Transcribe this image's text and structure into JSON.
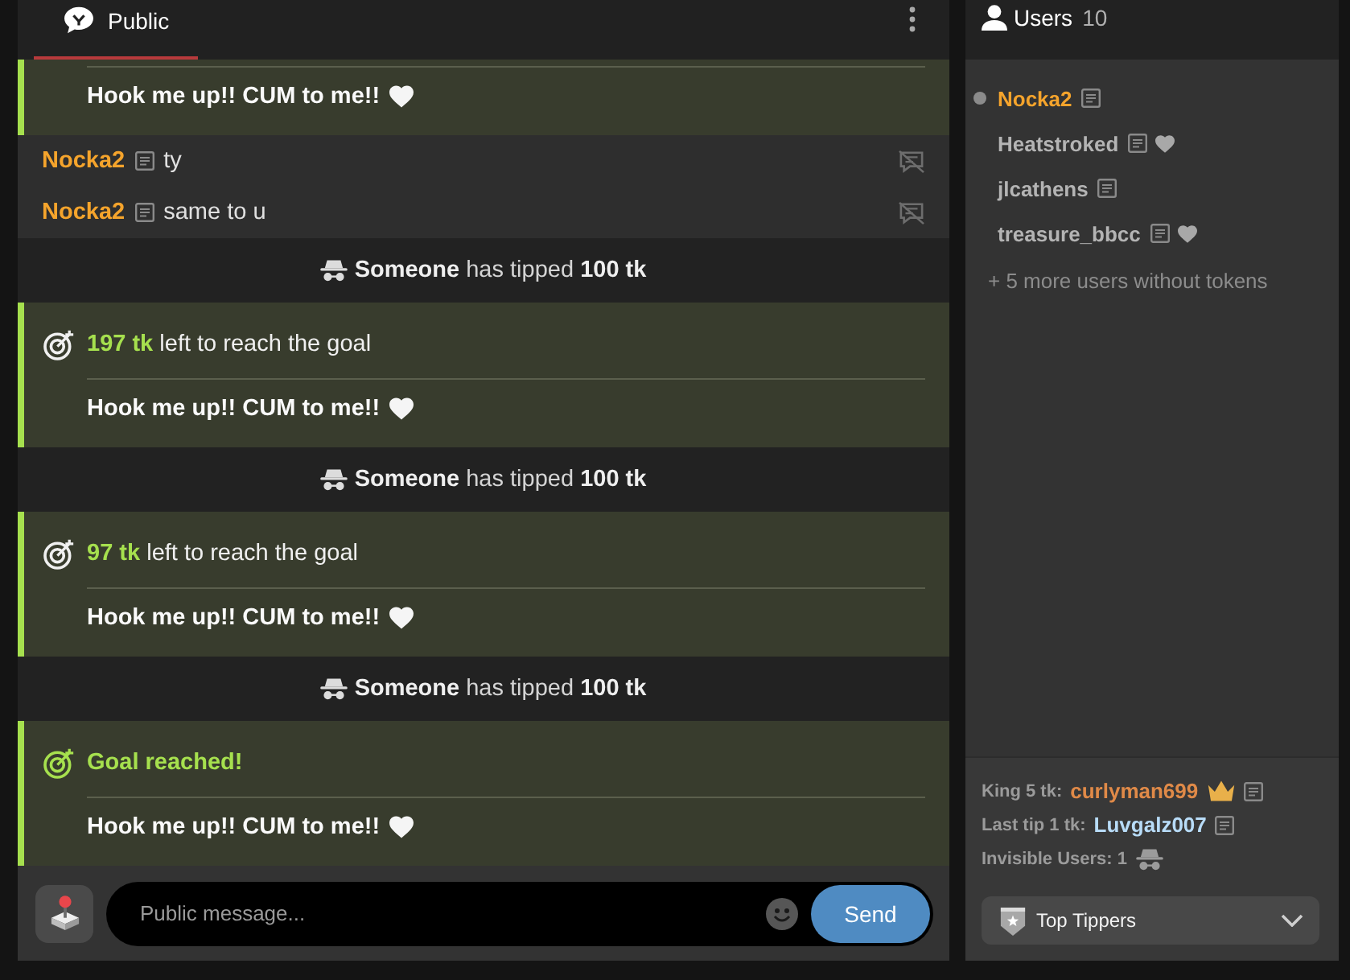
{
  "chat_tabs": [
    {
      "label": "Public",
      "selected": true
    }
  ],
  "messages": [
    {
      "kind": "goal",
      "text": "Hook me up!! CUM to me!!"
    },
    {
      "kind": "chat",
      "user": "Nocka2",
      "color": "#f5a42c",
      "text": "ty"
    },
    {
      "kind": "chat",
      "user": "Nocka2",
      "color": "#f5a42c",
      "text": "same to u"
    },
    {
      "kind": "tip",
      "text": "**Someone** has tipped **100 tk**"
    },
    {
      "kind": "goal",
      "reached": false,
      "headline": "**197 tk** left to reach the goal",
      "text": "Hook me up!! CUM to me!!"
    },
    {
      "kind": "tip",
      "text": "**Someone** has tipped **100 tk**"
    },
    {
      "kind": "goal",
      "reached": false,
      "headline": "**97 tk** left to reach the goal",
      "text": "Hook me up!! CUM to me!!"
    },
    {
      "kind": "tip",
      "text": "**Someone** has tipped **100 tk**"
    },
    {
      "kind": "goal",
      "reached": true,
      "headline": "Goal reached!",
      "text": "Hook me up!! CUM to me!!"
    }
  ],
  "composer": {
    "placeholder": "Public message...",
    "send": "Send"
  },
  "users_panel": {
    "title": "Users",
    "count": "10",
    "users": [
      {
        "name": "Nocka2",
        "color": "#f5a42c",
        "current": true,
        "favorite": false
      },
      {
        "name": "Heatstroked",
        "color": "#b4b4b4",
        "current": false,
        "favorite": true
      },
      {
        "name": "jlcathens",
        "color": "#b4b4b4",
        "current": false,
        "favorite": false
      },
      {
        "name": "treasure_bbcc",
        "color": "#b4b4b4",
        "current": false,
        "favorite": true
      }
    ],
    "more": "+ 5 more users without tokens"
  },
  "stats": [
    {
      "kind": "king",
      "label": "King 5 tk:",
      "user": "curlyman699",
      "color": "#e08a48"
    },
    {
      "kind": "last_tip",
      "label": "Last tip 1 tk:",
      "user": "Luvgalz007",
      "color": "#b8dcf8"
    },
    {
      "kind": "invisible",
      "label": "Invisible Users: 1"
    }
  ],
  "top_tippers": {
    "label": "Top Tippers",
    "expanded": false
  }
}
